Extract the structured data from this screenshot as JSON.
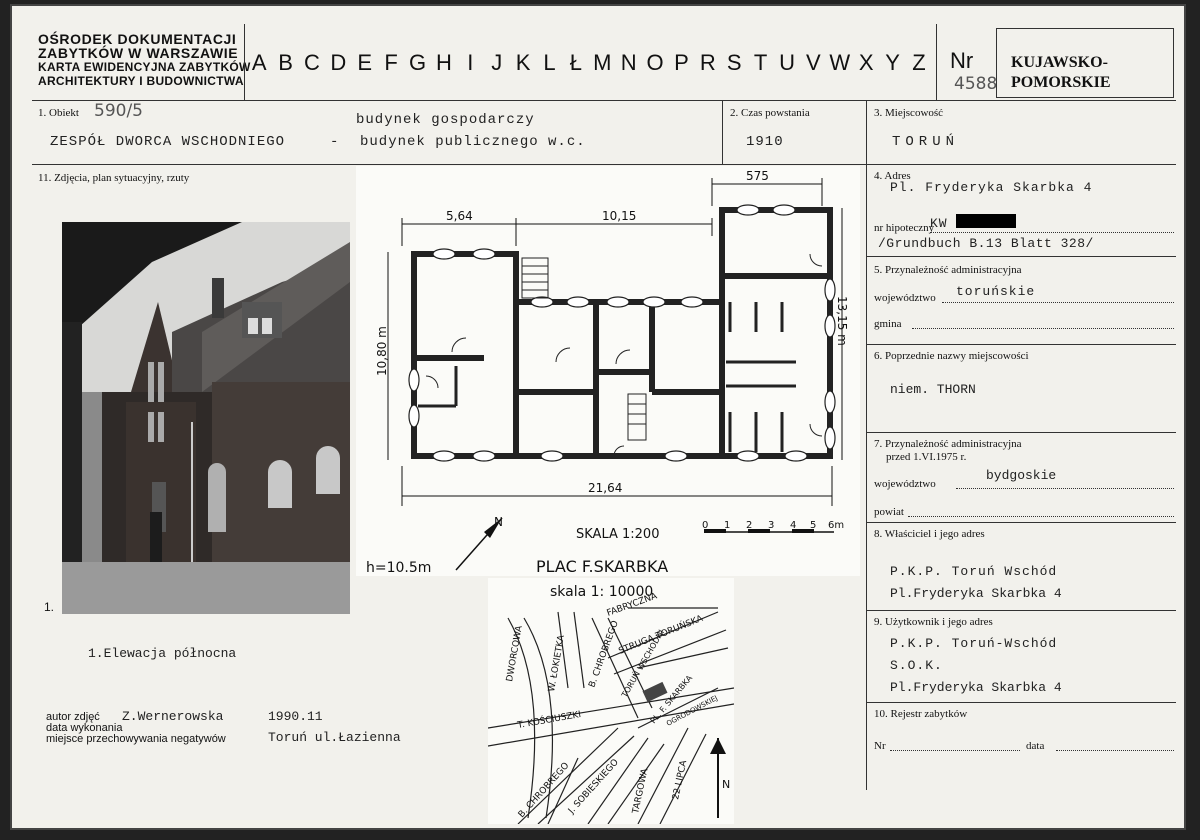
{
  "header": {
    "institution": [
      "OŚRODEK DOKUMENTACJI",
      "ZABYTKÓW W WARSZAWIE",
      "KARTA EWIDENCYJNA ZABYTKÓW",
      "ARCHITEKTURY I BUDOWNICTWA"
    ],
    "alphabet": [
      "A",
      "B",
      "C",
      "D",
      "E",
      "F",
      "G",
      "H",
      "I",
      "J",
      "K",
      "L",
      "Ł",
      "M",
      "N",
      "O",
      "P",
      "R",
      "S",
      "T",
      "U",
      "V",
      "W",
      "X",
      "Y",
      "Z"
    ],
    "nr_label": "Nr",
    "nr_handwritten": "4588",
    "region": [
      "KUJAWSKO-",
      "POMORSKIE"
    ]
  },
  "field1": {
    "label": "1. Obiekt",
    "hand_number": "590/5",
    "line_upper": "budynek gospodarczy",
    "line_main_left": "ZESPÓŁ DWORCA WSCHODNIEGO",
    "line_dash": "-",
    "line_main_right": "budynek publicznego w.c."
  },
  "field2": {
    "label": "2. Czas powstania",
    "value": "1910"
  },
  "field3": {
    "label": "3. Miejscowość",
    "value": "TORUŃ"
  },
  "field11": {
    "label": "11. Zdjęcia, plan sytuacyjny, rzuty"
  },
  "photo": {
    "number": "1.",
    "caption": "1.Elewacja północna"
  },
  "plan": {
    "dim_top_right": "575",
    "dim_564": "5,64",
    "dim_1015": "10,15",
    "dim_left": "10,80 m",
    "dim_right": "13,15 m",
    "dim_bottom": "21,64",
    "scale_label": "SKALA 1:200",
    "scale_ticks": [
      "0",
      "1",
      "2",
      "3",
      "4",
      "5",
      "6m"
    ],
    "height_label": "h=10.5m",
    "north": "N",
    "square": "PLAC F.SKARBKA"
  },
  "map": {
    "scale_label": "skala 1: 10000",
    "streets": [
      "FABRYCZNA",
      "DWORCOWA",
      "W. ŁOKIETKA",
      "B. CHROBREGO",
      "STRUGA TORUŃSKA",
      "TORUŃ WSCHODNI",
      "PL. F. SKARBKA",
      "T. KOŚCIUSZKI",
      "OGRODOWSKIEJ",
      "B. CHROBREGO",
      "J. SOBIESKIEGO",
      "TARGOWA",
      "22 LIPCA"
    ],
    "north": "N"
  },
  "field4": {
    "label": "4. Adres",
    "value": "Pl. Fryderyka Skarbka 4",
    "hipo_label": "nr hipoteczny",
    "hipo_value": "KW",
    "grundbuch": "/Grundbuch B.13 Blatt 328/"
  },
  "field5": {
    "label": "5. Przynależność administracyjna",
    "woj_label": "województwo",
    "woj_value": "toruńskie",
    "gmina_label": "gmina"
  },
  "field6": {
    "label": "6. Poprzednie nazwy miejscowości",
    "value": "niem. THORN"
  },
  "field7": {
    "label_line1": "7. Przynależność administracyjna",
    "label_line2": "przed 1.VI.1975 r.",
    "woj_label": "województwo",
    "woj_value": "bydgoskie",
    "powiat_label": "powiat"
  },
  "field8": {
    "label": "8. Właściciel i jego adres",
    "line1": "P.K.P. Toruń Wschód",
    "line2": "Pl.Fryderyka Skarbka 4"
  },
  "field9": {
    "label": "9. Użytkownik i jego adres",
    "line1": "P.K.P. Toruń-Wschód",
    "line2": "S.O.K.",
    "line3": "Pl.Fryderyka Skarbka 4"
  },
  "field10": {
    "label": "10. Rejestr zabytków",
    "nr_label": "Nr",
    "data_label": "data"
  },
  "footer": {
    "author_label": "autor zdjęć",
    "date_label": "data wykonania",
    "storage_label": "miejsce przechowywania negatywów",
    "author_value": "Z.Wernerowska",
    "date_value": "1990.11",
    "storage_value": "Toruń ul.Łazienna"
  }
}
